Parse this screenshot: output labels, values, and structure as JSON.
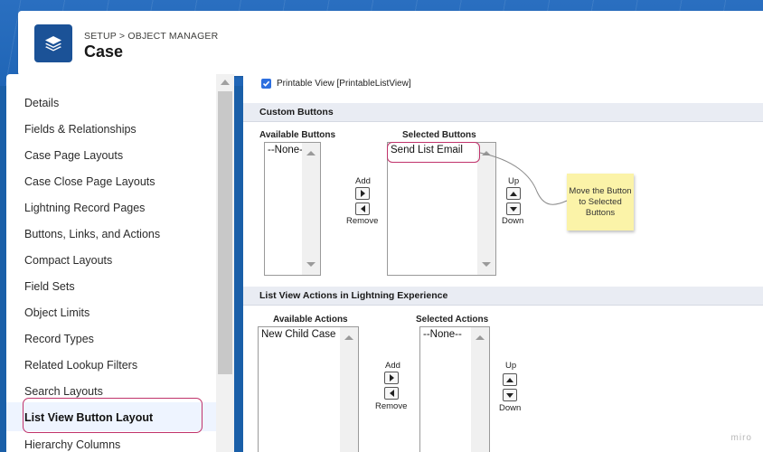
{
  "header": {
    "breadcrumb": "SETUP > OBJECT MANAGER",
    "title": "Case",
    "icon": "layers-icon"
  },
  "sidebar": {
    "items": [
      {
        "label": "Details"
      },
      {
        "label": "Fields & Relationships"
      },
      {
        "label": "Case Page Layouts"
      },
      {
        "label": "Case Close Page Layouts"
      },
      {
        "label": "Lightning Record Pages"
      },
      {
        "label": "Buttons, Links, and Actions"
      },
      {
        "label": "Compact Layouts"
      },
      {
        "label": "Field Sets"
      },
      {
        "label": "Object Limits"
      },
      {
        "label": "Record Types"
      },
      {
        "label": "Related Lookup Filters"
      },
      {
        "label": "Search Layouts"
      },
      {
        "label": "List View Button Layout",
        "active": true
      },
      {
        "label": "Hierarchy Columns"
      }
    ]
  },
  "main": {
    "printable_view_label": "Printable View [PrintableListView]",
    "printable_view_checked": true,
    "custom_buttons": {
      "section_title": "Custom Buttons",
      "available_label": "Available Buttons",
      "selected_label": "Selected Buttons",
      "available_items": [
        "--None--"
      ],
      "selected_items": [
        "Send List Email"
      ],
      "add_label": "Add",
      "remove_label": "Remove",
      "up_label": "Up",
      "down_label": "Down"
    },
    "list_view_actions": {
      "section_title": "List View Actions in Lightning Experience",
      "available_label": "Available Actions",
      "selected_label": "Selected Actions",
      "available_items": [
        "New Child Case"
      ],
      "selected_items": [
        "--None--"
      ],
      "add_label": "Add",
      "remove_label": "Remove",
      "up_label": "Up",
      "down_label": "Down"
    }
  },
  "annotation": {
    "sticky_note": "Move the Button to Selected Buttons"
  },
  "watermark": "miro",
  "colors": {
    "banner": "#1f65b6",
    "highlight": "#c0336b",
    "checkbox": "#2d6fdf",
    "sticky": "#fbf3a8"
  }
}
